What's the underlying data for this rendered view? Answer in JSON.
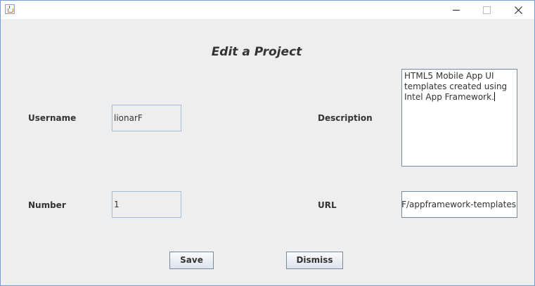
{
  "window": {
    "title": "",
    "icon": "java-cup-icon",
    "controls": {
      "minimize_icon": "minimize-icon",
      "maximize_icon": "maximize-icon",
      "close_icon": "close-icon"
    }
  },
  "form": {
    "heading": "Edit a Project",
    "username_label": "Username",
    "username_value": "lionarF",
    "number_label": "Number",
    "number_value": "1",
    "description_label": "Description",
    "description_value": "HTML5 Mobile App UI templates created using Intel App Framework.",
    "url_label": "URL",
    "url_value": "rGF/appframework-templates"
  },
  "buttons": {
    "save_label": "Save",
    "dismiss_label": "Dismiss"
  },
  "colors": {
    "panel_background": "#eeeeee",
    "window_border": "#7a9cc6",
    "readonly_field_border": "#a7bcd4",
    "text": "#333333"
  }
}
